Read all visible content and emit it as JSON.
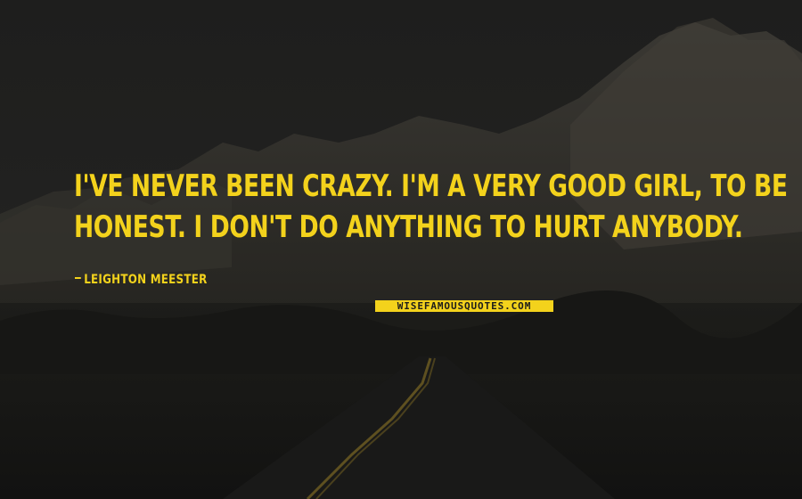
{
  "quote": {
    "lines": [
      "I'VE NEVER BEEN CRAZY. I'M A VERY GOOD GIRL, TO BE",
      "HONEST. I DON'T DO ANYTHING TO HURT ANYBODY."
    ]
  },
  "author": {
    "name": "LEIGHTON MEESTER"
  },
  "watermark": {
    "text": "WISEFAMOUSQUOTES.COM"
  },
  "colors": {
    "text": "#f3d21c",
    "background": "#1c1c1b"
  }
}
